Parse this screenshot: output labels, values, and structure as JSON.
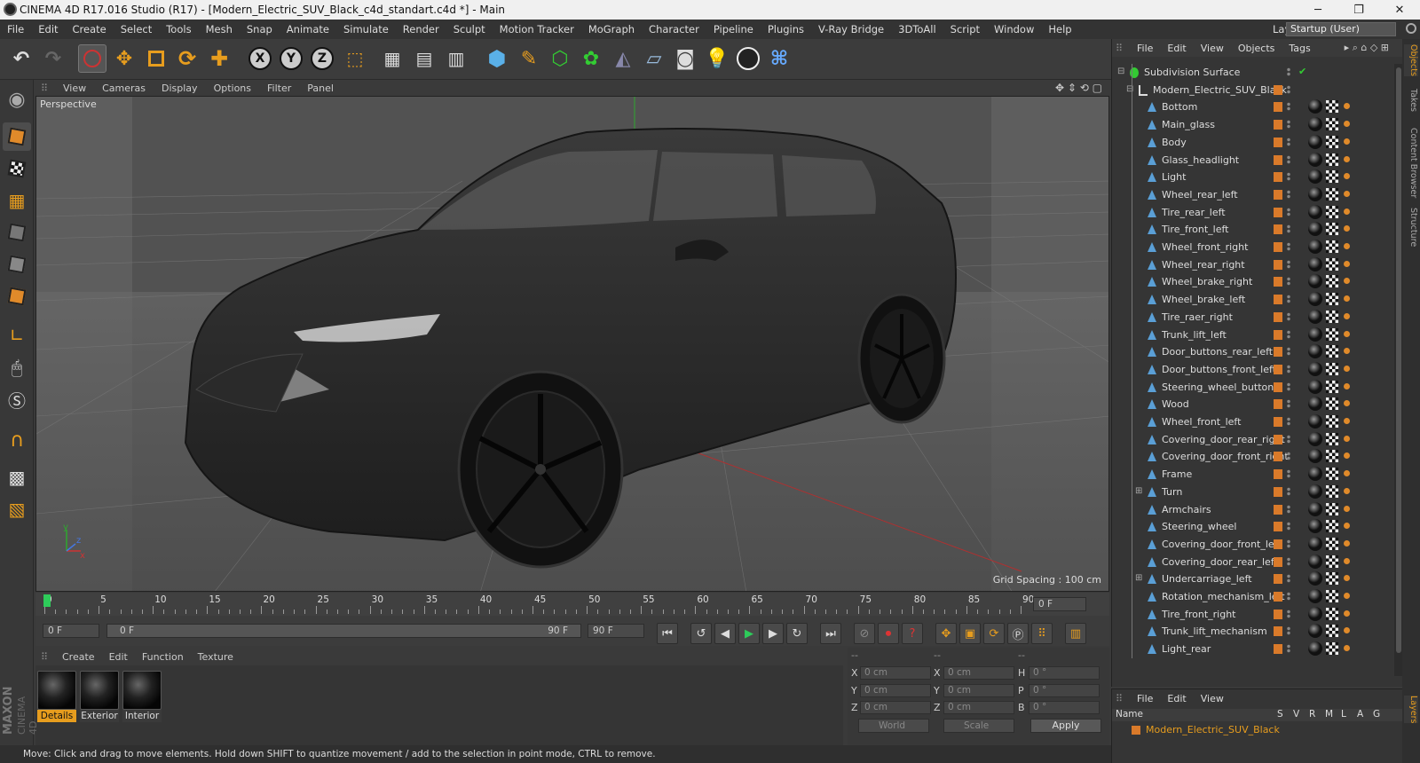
{
  "window": {
    "title": "CINEMA 4D R17.016 Studio (R17) - [Modern_Electric_SUV_Black_c4d_standart.c4d *] - Main",
    "minimize": "─",
    "maximize": "❐",
    "close": "✕"
  },
  "menubar": {
    "items": [
      "File",
      "Edit",
      "Create",
      "Select",
      "Tools",
      "Mesh",
      "Snap",
      "Animate",
      "Simulate",
      "Render",
      "Sculpt",
      "Motion Tracker",
      "MoGraph",
      "Character",
      "Pipeline",
      "Plugins",
      "V-Ray Bridge",
      "3DToAll",
      "Script",
      "Window",
      "Help"
    ],
    "layout_label": "Layout:",
    "layout_value": "Startup (User)"
  },
  "toolbar": {
    "axis_x": "X",
    "axis_y": "Y",
    "axis_z": "Z"
  },
  "viewport": {
    "menu": [
      "View",
      "Cameras",
      "Display",
      "Options",
      "Filter",
      "Panel"
    ],
    "label": "Perspective",
    "grid_spacing": "Grid Spacing : 100 cm",
    "axis_y": "y",
    "axis_x": "x",
    "axis_z": "z"
  },
  "timeline": {
    "ticks": [
      "0",
      "5",
      "10",
      "15",
      "20",
      "25",
      "30",
      "35",
      "40",
      "45",
      "50",
      "55",
      "60",
      "65",
      "70",
      "75",
      "80",
      "85",
      "90"
    ],
    "current_frame": "0 F",
    "start_frame": "0 F",
    "range_start": "0 F",
    "range_end": "90 F",
    "end_frame": "90 F"
  },
  "materials": {
    "menu": [
      "Create",
      "Edit",
      "Function",
      "Texture"
    ],
    "items": [
      {
        "name": "Details",
        "active": true
      },
      {
        "name": "Exterior",
        "active": false
      },
      {
        "name": "Interior",
        "active": false
      }
    ],
    "logo_line1": "MAXON",
    "logo_line2": "CINEMA 4D"
  },
  "coordinates": {
    "header_left": "--",
    "header_mid": "--",
    "header_right": "--",
    "rows": [
      {
        "a": "X",
        "av": "0 cm",
        "b": "X",
        "bv": "0 cm",
        "c": "H",
        "cv": "0 °"
      },
      {
        "a": "Y",
        "av": "0 cm",
        "b": "Y",
        "bv": "0 cm",
        "c": "P",
        "cv": "0 °"
      },
      {
        "a": "Z",
        "av": "0 cm",
        "b": "Z",
        "bv": "0 cm",
        "c": "B",
        "cv": "0 °"
      }
    ],
    "mode": "World",
    "scale": "Scale",
    "apply": "Apply"
  },
  "status": {
    "text": "Move: Click and drag to move elements. Hold down SHIFT to quantize movement / add to the selection in point mode, CTRL to remove."
  },
  "objects": {
    "menu": [
      "File",
      "Edit",
      "View",
      "Objects",
      "Tags"
    ],
    "root": "Subdivision Surface",
    "group": "Modern_Electric_SUV_Black",
    "children": [
      "Bottom",
      "Main_glass",
      "Body",
      "Glass_headlight",
      "Light",
      "Wheel_rear_left",
      "Tire_rear_left",
      "Tire_front_left",
      "Wheel_front_right",
      "Wheel_rear_right",
      "Wheel_brake_right",
      "Wheel_brake_left",
      "Tire_raer_right",
      "Trunk_lift_left",
      "Door_buttons_rear_left",
      "Door_buttons_front_left",
      "Steering_wheel_buttons",
      "Wood",
      "Wheel_front_left",
      "Covering_door_rear_right",
      "Covering_door_front_right",
      "Frame",
      "Turn",
      "Armchairs",
      "Steering_wheel",
      "Covering_door_front_left",
      "Covering_door_rear_left",
      "Undercarriage_left",
      "Rotation_mechanism_left",
      "Tire_front_right",
      "Trunk_lift_mechanism",
      "Light_rear"
    ],
    "expandable": [
      "Turn",
      "Undercarriage_left"
    ]
  },
  "layers": {
    "menu": [
      "File",
      "Edit",
      "View"
    ],
    "header_name": "Name",
    "header_cols": [
      "S",
      "V",
      "R",
      "M",
      "L",
      "A",
      "G"
    ],
    "row_name": "Modern_Electric_SUV_Black"
  },
  "sidetabs": [
    "Objects",
    "Takes",
    "Content Browser",
    "Structure",
    "Layers"
  ],
  "colors": {
    "accent": "#e79d1e",
    "object_orange": "#d97a2a",
    "viewport_bg": "#5b5b5b",
    "panel_bg": "#353535"
  }
}
